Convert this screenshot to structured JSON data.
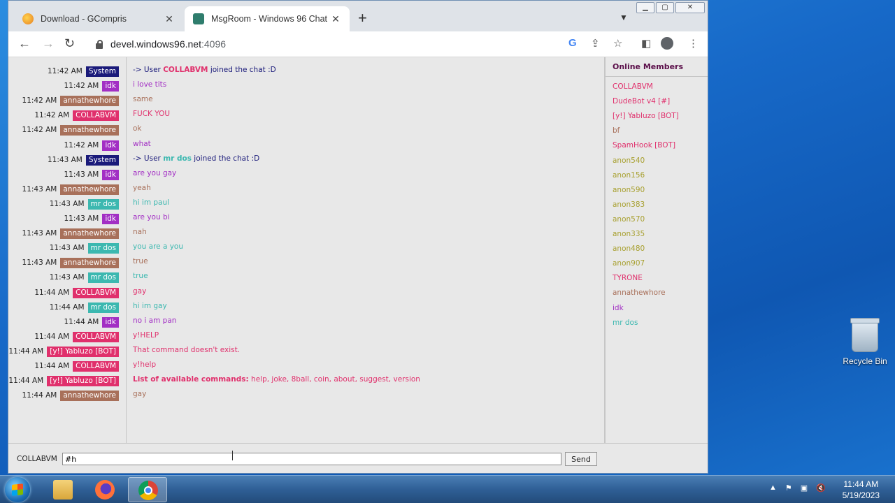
{
  "browser": {
    "tabs": [
      {
        "title": "Download - GCompris"
      },
      {
        "title": "MsgRoom - Windows 96 Chat"
      }
    ],
    "url_host": "devel.windows96.net",
    "url_port": ":4096"
  },
  "chat": {
    "messages": [
      {
        "time": "11:42 AM",
        "user": "System",
        "text_pre": "-> User ",
        "text_strong": "COLLABVM",
        "text": " joined the chat :D"
      },
      {
        "time": "11:42 AM",
        "user": "idk",
        "text": "i love tits"
      },
      {
        "time": "11:42 AM",
        "user": "annathewhore",
        "text": "same"
      },
      {
        "time": "11:42 AM",
        "user": "COLLABVM",
        "text": "FUCK YOU"
      },
      {
        "time": "11:42 AM",
        "user": "annathewhore",
        "text": "ok"
      },
      {
        "time": "11:42 AM",
        "user": "idk",
        "text": "what"
      },
      {
        "time": "11:43 AM",
        "user": "System",
        "text_pre": "-> User ",
        "text_strong": "mr dos",
        "text": " joined the chat :D"
      },
      {
        "time": "11:43 AM",
        "user": "idk",
        "text": "are you gay"
      },
      {
        "time": "11:43 AM",
        "user": "annathewhore",
        "text": "yeah"
      },
      {
        "time": "11:43 AM",
        "user": "mr dos",
        "text": "hi im paul"
      },
      {
        "time": "11:43 AM",
        "user": "idk",
        "text": "are you bi"
      },
      {
        "time": "11:43 AM",
        "user": "annathewhore",
        "text": "nah"
      },
      {
        "time": "11:43 AM",
        "user": "mr dos",
        "text": "you are a you"
      },
      {
        "time": "11:43 AM",
        "user": "annathewhore",
        "text": "true"
      },
      {
        "time": "11:43 AM",
        "user": "mr dos",
        "text": "true"
      },
      {
        "time": "11:44 AM",
        "user": "COLLABVM",
        "text": "gay"
      },
      {
        "time": "11:44 AM",
        "user": "mr dos",
        "text": "hi im gay"
      },
      {
        "time": "11:44 AM",
        "user": "idk",
        "text": "no i am pan"
      },
      {
        "time": "11:44 AM",
        "user": "COLLABVM",
        "text": "y!HELP"
      },
      {
        "time": "11:44 AM",
        "user": "[y!] Yabluzo [BOT]",
        "text": "That command doesn't exist."
      },
      {
        "time": "11:44 AM",
        "user": "COLLABVM",
        "text": "y!help"
      },
      {
        "time": "11:44 AM",
        "user": "[y!] Yabluzo [BOT]",
        "text_strong": "List of available commands:",
        "text": " help, joke, 8ball, coin, about, suggest, version"
      },
      {
        "time": "11:44 AM",
        "user": "annathewhore",
        "text": "gay"
      }
    ]
  },
  "members": {
    "title": "Online Members",
    "list": [
      "COLLABVM",
      "DudeBot v4 [#]",
      "[y!] Yabluzo [BOT]",
      "bf",
      "SpamHook [BOT]",
      "anon540",
      "anon156",
      "anon590",
      "anon383",
      "anon570",
      "anon335",
      "anon480",
      "anon907",
      "TYRONE",
      "annathewhore",
      "idk",
      "mr dos"
    ]
  },
  "input": {
    "nickname": "COLLABVM",
    "value": "#h",
    "send_label": "Send"
  },
  "colors": {
    "System": "#1a1a7a",
    "idk": "#a22fc4",
    "annathewhore": "#a8705a",
    "COLLABVM": "#e0306c",
    "mr dos": "#3cb8b0",
    "[y!] Yabluzo [BOT]": "#e0306c",
    "DudeBot v4 [#]": "#e0306c",
    "bf": "#a8705a",
    "SpamHook [BOT]": "#e0306c",
    "anon": "#a8a030",
    "TYRONE": "#e0306c"
  },
  "desktop": {
    "recycle_bin": "Recycle Bin",
    "clock_time": "11:44 AM",
    "clock_date": "5/19/2023"
  }
}
